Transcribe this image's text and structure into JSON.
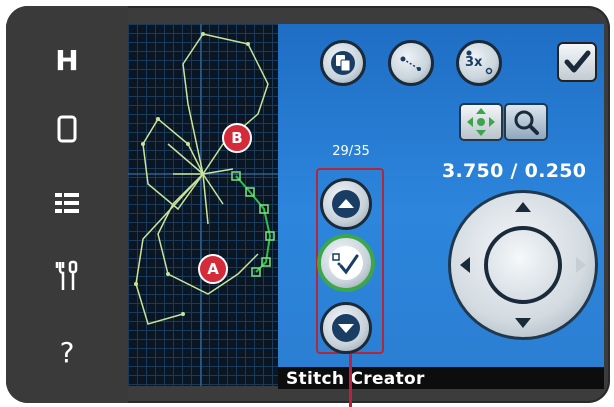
{
  "sidebar": {
    "items": [
      {
        "icon": "h-icon",
        "glyph": "H"
      },
      {
        "icon": "window-icon",
        "glyph": "▯"
      },
      {
        "icon": "list-icon",
        "glyph": "☰"
      },
      {
        "icon": "tools-icon",
        "glyph": "⚒"
      },
      {
        "icon": "help-icon",
        "glyph": "?"
      }
    ]
  },
  "toolbar": {
    "buttons": [
      {
        "icon": "copy-icon"
      },
      {
        "icon": "single-stitch-icon"
      },
      {
        "icon": "triple-stitch-icon",
        "label": "3x"
      }
    ],
    "confirm_icon": "checkmark-icon"
  },
  "stitch_counter": "29/35",
  "tools": {
    "move_icon": "move-arrows-icon",
    "zoom_icon": "magnifier-icon"
  },
  "position_readout": "3.750 / 0.250",
  "navigation": {
    "up_icon": "arrow-up-icon",
    "down_icon": "arrow-down-icon",
    "select_icon": "select-stitch-icon"
  },
  "markers": {
    "a": "A",
    "b": "B"
  },
  "status_bar": {
    "title": "Stitch Creator"
  },
  "colors": {
    "panel_blue": "#2b7fd3",
    "marker_red": "#d42a3a",
    "selection_green": "#3ba64a",
    "stitch_line": "#b9e08a"
  }
}
